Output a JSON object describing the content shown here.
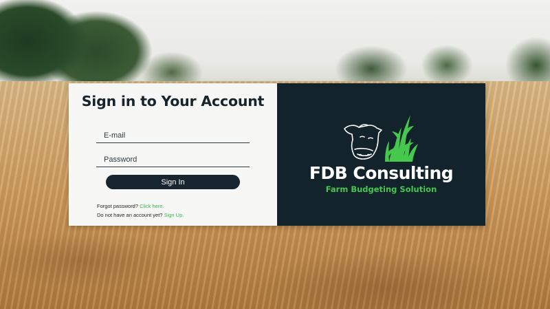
{
  "login": {
    "title": "Sign in to Your Account",
    "email_placeholder": "E-mail",
    "password_placeholder": "Password",
    "signin_label": "Sign In",
    "forgot_text": "Forgot password?",
    "forgot_link": "Click here.",
    "signup_text": "Do not have an account yet?",
    "signup_link": "Sign Up."
  },
  "brand": {
    "name": "FDB Consulting",
    "tagline": "Farm Budgeting Solution",
    "logo_icon": "cow-and-grass-icon"
  },
  "colors": {
    "panel_dark": "#12232b",
    "accent_green": "#46c84f",
    "button": "#16252e",
    "panel_light": "#f7f7f6"
  }
}
